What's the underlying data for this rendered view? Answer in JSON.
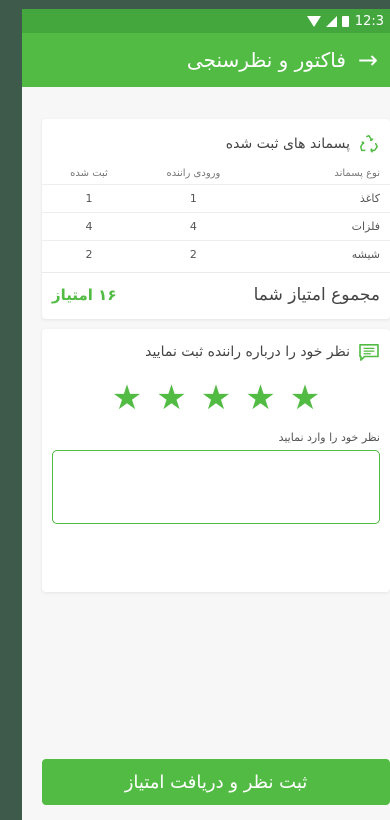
{
  "status_bar": {
    "time": "12:3"
  },
  "appbar": {
    "title": "فاکتور و نظرسنجی",
    "back_icon": "arrow-icon"
  },
  "waste_card": {
    "title": "پسماند های ثبت شده",
    "icon": "recycle-icon",
    "columns": [
      "نوع پسماند",
      "ورودی راننده",
      "ثبت شده"
    ],
    "rows": [
      [
        "کاغذ",
        "1",
        "1"
      ],
      [
        "فلزات",
        "4",
        "4"
      ],
      [
        "شیشه",
        "2",
        "2"
      ]
    ],
    "total_label": "مجموع امتیاز شما",
    "total_value": "۱۶ امتیاز"
  },
  "comment_card": {
    "title": "نظر خود را درباره راننده ثبت نمایید",
    "icon": "comment-icon",
    "rating": 5,
    "input_label": "نظر خود را وارد نمایید",
    "input_value": ""
  },
  "submit_label": "ثبت نظر و دریافت امتیاز",
  "colors": {
    "primary": "#52bb44",
    "status_bar": "#43a73e"
  }
}
